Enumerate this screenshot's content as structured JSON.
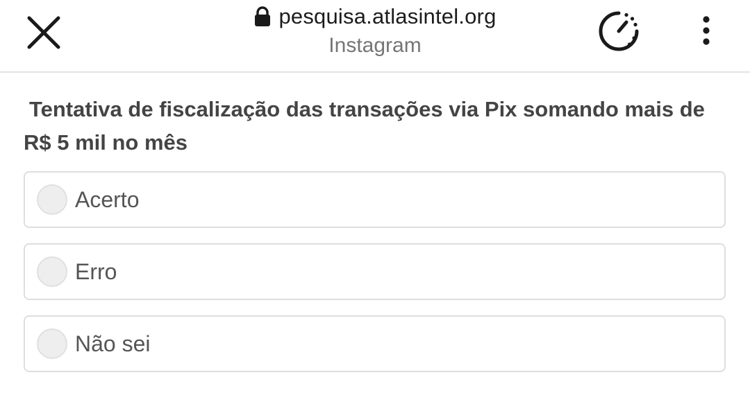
{
  "header": {
    "url": "pesquisa.atlasintel.org",
    "source_app": "Instagram",
    "icons": {
      "close": "close-icon",
      "lock": "lock-icon",
      "timer": "timer-icon",
      "menu": "more-vert-icon"
    }
  },
  "survey": {
    "question": "Tentativa de fiscalização das transações via Pix somando mais de R$ 5 mil no mês",
    "options": [
      {
        "label": "Acerto",
        "selected": false
      },
      {
        "label": "Erro",
        "selected": false
      },
      {
        "label": "Não sei",
        "selected": false
      }
    ]
  }
}
